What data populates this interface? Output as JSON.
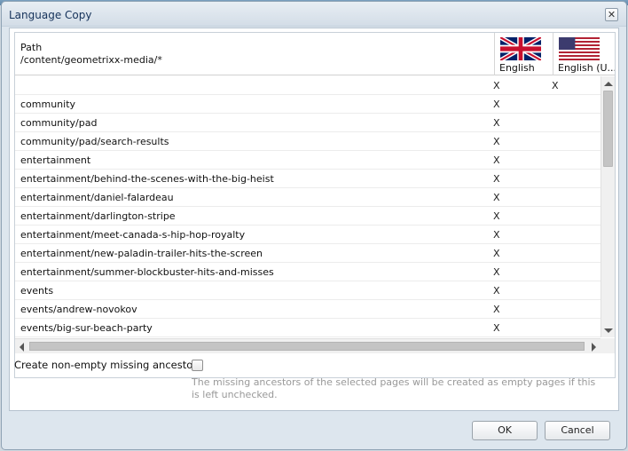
{
  "dialog": {
    "title": "Language Copy",
    "close_glyph": "✕"
  },
  "grid": {
    "path_header": "Path",
    "path_root": "/content/geometrixx-media/*",
    "languages": [
      {
        "label": "English",
        "flag": "uk-flag-icon"
      },
      {
        "label": "English (U...",
        "flag": "us-flag-icon"
      }
    ],
    "rows": [
      {
        "path": "",
        "c1": "X",
        "c2": "X"
      },
      {
        "path": "community",
        "c1": "X",
        "c2": ""
      },
      {
        "path": "community/pad",
        "c1": "X",
        "c2": ""
      },
      {
        "path": "community/pad/search-results",
        "c1": "X",
        "c2": ""
      },
      {
        "path": "entertainment",
        "c1": "X",
        "c2": ""
      },
      {
        "path": "entertainment/behind-the-scenes-with-the-big-heist",
        "c1": "X",
        "c2": ""
      },
      {
        "path": "entertainment/daniel-falardeau",
        "c1": "X",
        "c2": ""
      },
      {
        "path": "entertainment/darlington-stripe",
        "c1": "X",
        "c2": ""
      },
      {
        "path": "entertainment/meet-canada-s-hip-hop-royalty",
        "c1": "X",
        "c2": ""
      },
      {
        "path": "entertainment/new-paladin-trailer-hits-the-screen",
        "c1": "X",
        "c2": ""
      },
      {
        "path": "entertainment/summer-blockbuster-hits-and-misses",
        "c1": "X",
        "c2": ""
      },
      {
        "path": "events",
        "c1": "X",
        "c2": ""
      },
      {
        "path": "events/andrew-novokov",
        "c1": "X",
        "c2": ""
      },
      {
        "path": "events/big-sur-beach-party",
        "c1": "X",
        "c2": ""
      }
    ]
  },
  "options": {
    "ancestors_label": "Create non-empty missing ancestors",
    "ancestors_checked": false,
    "ancestors_help": "The missing ancestors of the selected pages will be created as empty pages if this is left unchecked."
  },
  "footer": {
    "ok_label": "OK",
    "cancel_label": "Cancel"
  }
}
